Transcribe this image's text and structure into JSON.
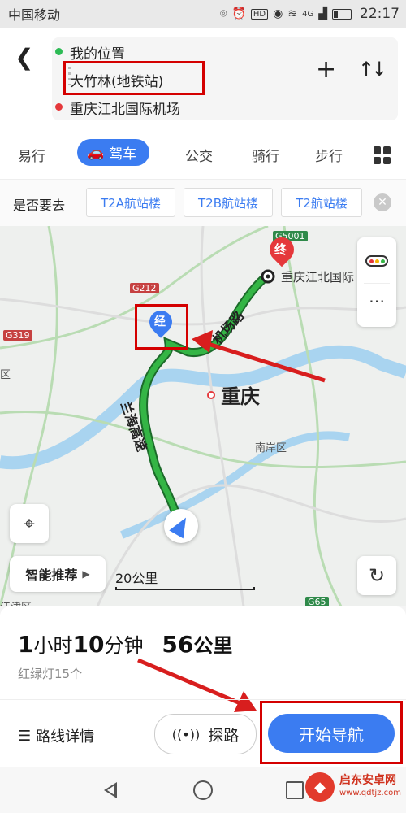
{
  "status": {
    "carrier": "中国移动",
    "time": "22:17",
    "network": "4G"
  },
  "route": {
    "origin": "我的位置",
    "waypoint": "大竹林(地铁站)",
    "destination": "重庆江北国际机场",
    "back_icon": "chevron-left-icon",
    "add_icon": "plus-icon",
    "swap_icon": "swap-icon"
  },
  "modes": [
    {
      "label": "易行"
    },
    {
      "label": "驾车",
      "active": true
    },
    {
      "label": "公交"
    },
    {
      "label": "骑行"
    },
    {
      "label": "步行"
    }
  ],
  "suggest": {
    "question": "是否要去",
    "chips": [
      "T2A航站楼",
      "T2B航站楼",
      "T2航站楼"
    ]
  },
  "map": {
    "city": "重庆",
    "district": "南岸区",
    "airport": "重庆江北国际",
    "via_marker": "经",
    "end_marker": "终",
    "roads": {
      "g5001": "G5001",
      "g212": "G212",
      "g319": "G319",
      "g65": "G65"
    },
    "road_names": [
      "机场路",
      "兰海高速"
    ],
    "edge_labels": [
      "区",
      "江津区"
    ],
    "smart_recommend": "智能推荐",
    "scale": "20公里"
  },
  "summary": {
    "hours": "1",
    "hours_unit": "小时",
    "minutes": "10",
    "minutes_unit": "分钟",
    "distance": "56",
    "distance_unit": "公里",
    "lights": "红绿灯15个"
  },
  "actions": {
    "details": "路线详情",
    "explore": "探路",
    "start": "开始导航"
  },
  "watermark": {
    "name": "启东安卓网",
    "url": "www.qdtjz.com"
  },
  "colors": {
    "accent": "#3b7cf1",
    "highlight_box": "#d40000",
    "route": "#34b545",
    "destination": "#e5383b"
  }
}
